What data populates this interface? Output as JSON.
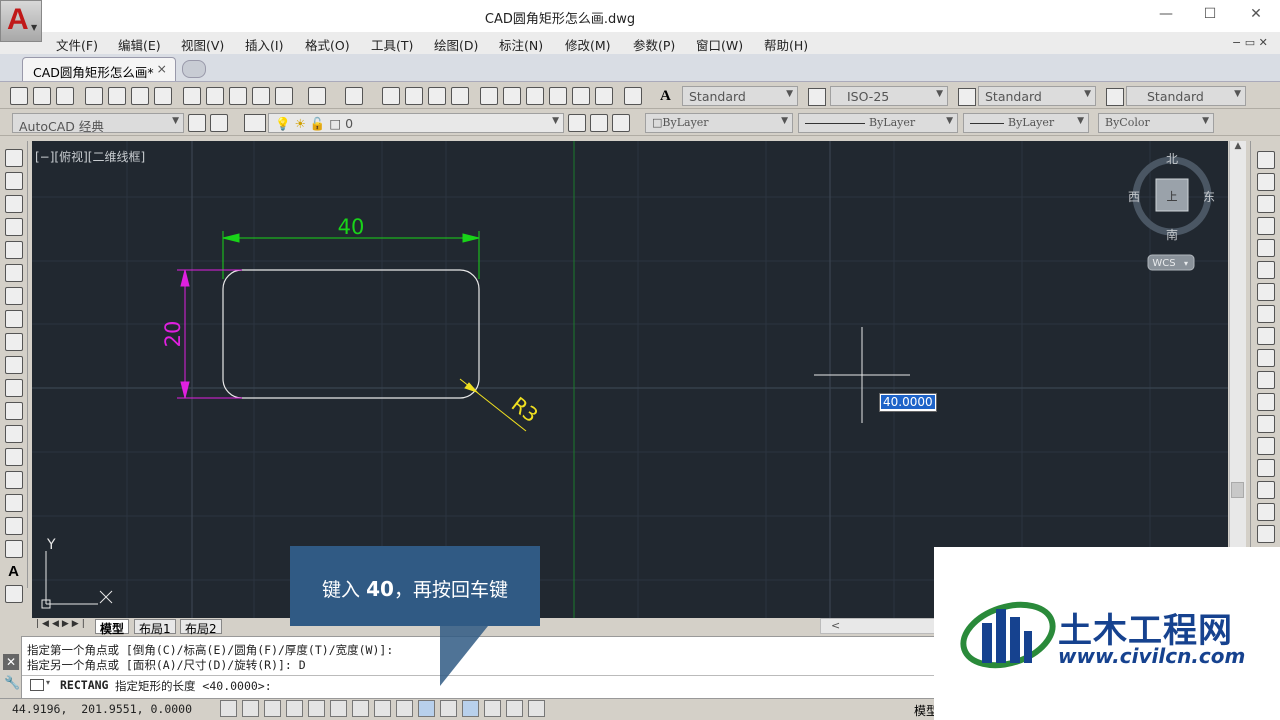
{
  "app": {
    "title": "CAD圆角矩形怎么画.dwg",
    "logo": "A"
  },
  "menu": [
    "文件(F)",
    "编辑(E)",
    "视图(V)",
    "插入(I)",
    "格式(O)",
    "工具(T)",
    "绘图(D)",
    "标注(N)",
    "修改(M)",
    "参数(P)",
    "窗口(W)",
    "帮助(H)"
  ],
  "doc_tab": {
    "label": "CAD圆角矩形怎么画*",
    "close": "×"
  },
  "toolbar": {
    "text_style": "Standard",
    "dim_style": "ISO-25",
    "table_style": "Standard",
    "multileader_style": "Standard",
    "workspace": "AutoCAD 经典",
    "layer": "0",
    "color": "ByLayer",
    "linetype": "ByLayer",
    "lineweight": "ByLayer",
    "plotstyle": "ByColor"
  },
  "viewport": {
    "label": "[−][俯视][二维线框]"
  },
  "viewcube": {
    "north": "北",
    "south": "南",
    "east": "东",
    "west": "西",
    "wcs": "WCS"
  },
  "drawing": {
    "dim_width": "40",
    "dim_height": "20",
    "radius_label": "R3"
  },
  "dynamic_input": {
    "value": "40.0000"
  },
  "ucs": {
    "y": "Y",
    "x": "X"
  },
  "layout_tabs": [
    "模型",
    "布局1",
    "布局2"
  ],
  "command": {
    "line1": "指定第一个角点或 [倒角(C)/标高(E)/圆角(F)/厚度(T)/宽度(W)]:",
    "line2": "指定另一个角点或 [面积(A)/尺寸(D)/旋转(R)]: D",
    "prompt_cmd": "RECTANG",
    "prompt_text": "指定矩形的长度 <40.0000>:"
  },
  "status": {
    "coords": "44.9196,  201.9551, 0.0000",
    "model": "模型"
  },
  "callout": {
    "text_pre": "键入 ",
    "value": "40",
    "text_post": "，再按回车键"
  },
  "watermark": {
    "title": "土木工程网",
    "url": "www.civilcn.com"
  },
  "colors": {
    "canvas": "#212830",
    "dim_green": "#19d419",
    "dim_magenta": "#e020e0",
    "radius_yellow": "#f0e020",
    "callout": "#305a84",
    "watermark_blue": "#16428f"
  }
}
